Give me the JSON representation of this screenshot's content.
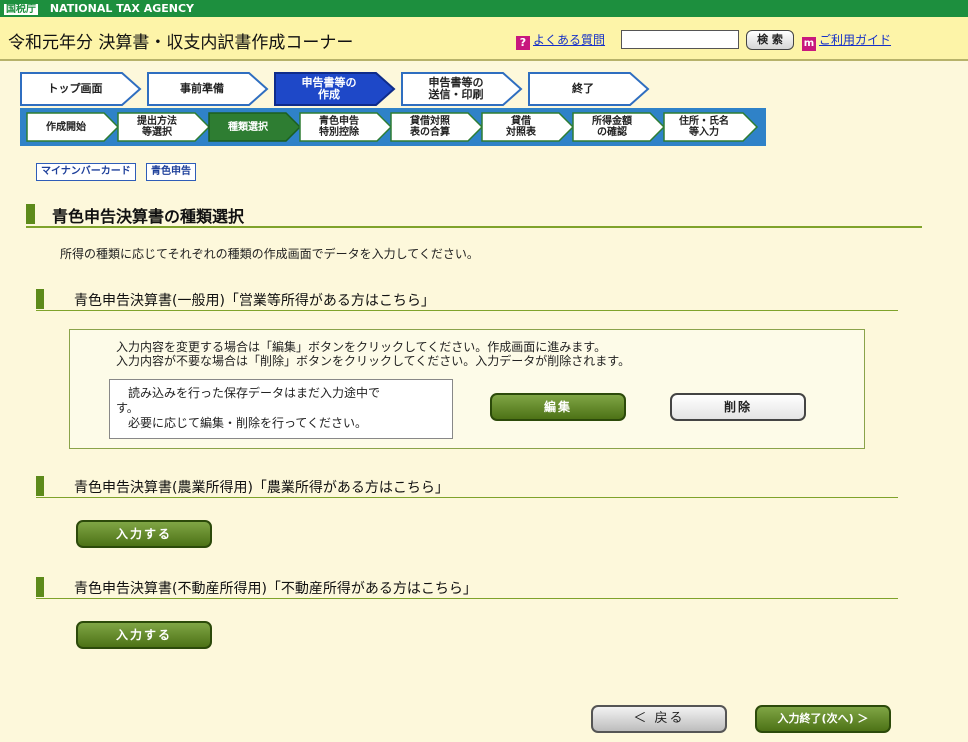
{
  "agency": {
    "logo": "国税庁",
    "name": "NATIONAL TAX AGENCY"
  },
  "header": {
    "title": "令和元年分 決算書・収支内訳書作成コーナー",
    "faq_label": "よくある質問",
    "search_placeholder": "",
    "search_button": "検 索",
    "guide_label": "ご利用ガイド"
  },
  "steps": {
    "main": [
      {
        "label": "トップ画面",
        "active": false
      },
      {
        "label": "事前準備",
        "active": false
      },
      {
        "label": "申告書等の\n作成",
        "active": true
      },
      {
        "label": "申告書等の\n送信・印刷",
        "active": false
      },
      {
        "label": "終了",
        "active": false
      }
    ],
    "sub": [
      {
        "label": "作成開始",
        "active": false
      },
      {
        "label": "提出方法\n等選択",
        "active": false
      },
      {
        "label": "種類選択",
        "active": true
      },
      {
        "label": "青色申告\n特別控除",
        "active": false
      },
      {
        "label": "貸借対照\n表の合算",
        "active": false
      },
      {
        "label": "貸借\n対照表",
        "active": false
      },
      {
        "label": "所得金額\nの確認",
        "active": false
      },
      {
        "label": "住所・氏名\n等入力",
        "active": false
      }
    ]
  },
  "tags": {
    "mynumber": "マイナンバーカード",
    "blue": "青色申告"
  },
  "page_title": "青色申告決算書の種類選択",
  "intro": "所得の種類に応じてそれぞれの種類の作成画面でデータを入力してください。",
  "sections": {
    "general": {
      "heading": "青色申告決算書(一般用)「営業等所得がある方はこちら」",
      "msg_line1": "入力内容を変更する場合は「編集」ボタンをクリックしてください。作成画面に進みます。",
      "msg_line2": "入力内容が不要な場合は「削除」ボタンをクリックしてください。入力データが削除されます。",
      "note_line1": "　読み込みを行った保存データはまだ入力途中で",
      "note_line2": "す。",
      "note_line3": "　必要に応じて編集・削除を行ってください。",
      "edit_button": "編集",
      "delete_button": "削除"
    },
    "agri": {
      "heading": "青色申告決算書(農業所得用)「農業所得がある方はこちら」",
      "input_button": "入力する"
    },
    "realestate": {
      "heading": "青色申告決算書(不動産所得用)「不動産所得がある方はこちら」",
      "input_button": "入力する"
    }
  },
  "footer": {
    "back_button": "＜ 戻る",
    "next_button": "入力終了(次へ) ＞"
  },
  "colors": {
    "accent_green": "#5d8a1a",
    "step_active": "#1e48c8",
    "sub_active": "#2e7d32",
    "header_bg": "#fdf4a8"
  }
}
